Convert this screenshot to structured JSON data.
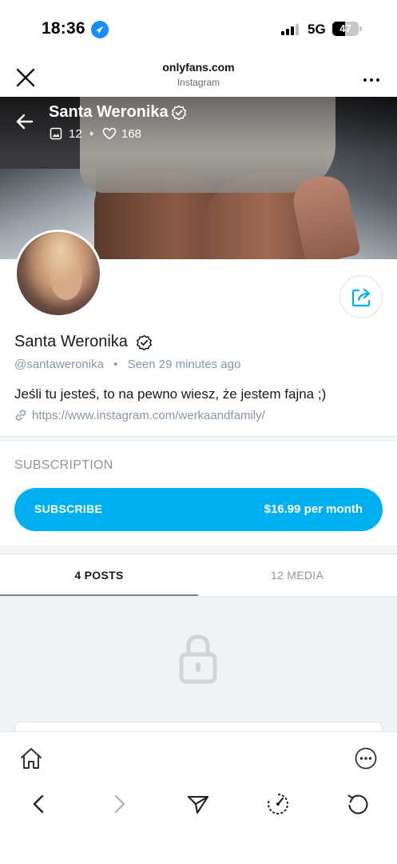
{
  "status_bar": {
    "time": "18:36",
    "network": "5G",
    "battery": "47"
  },
  "browser": {
    "url_title": "onlyfans.com",
    "url_subtitle": "Instagram"
  },
  "cover": {
    "name": "Santa Weronika",
    "photos_count": "12",
    "likes_count": "168"
  },
  "profile": {
    "name": "Santa Weronika",
    "handle": "@santaweronika",
    "seen": "Seen  29 minutes ago",
    "bio": "Jeśli tu jesteś, to na pewno wiesz, że jestem fajna ;)",
    "link": "https://www.instagram.com/werkaandfamily/"
  },
  "subscription": {
    "title": "SUBSCRIPTION",
    "button_label": "SUBSCRIBE",
    "price": "$16.99 per month"
  },
  "tabs": [
    {
      "label": "4 POSTS",
      "active": true
    },
    {
      "label": "12 MEDIA",
      "active": false
    }
  ],
  "colors": {
    "accent": "#00aff0",
    "muted_text": "#8a96a3"
  }
}
